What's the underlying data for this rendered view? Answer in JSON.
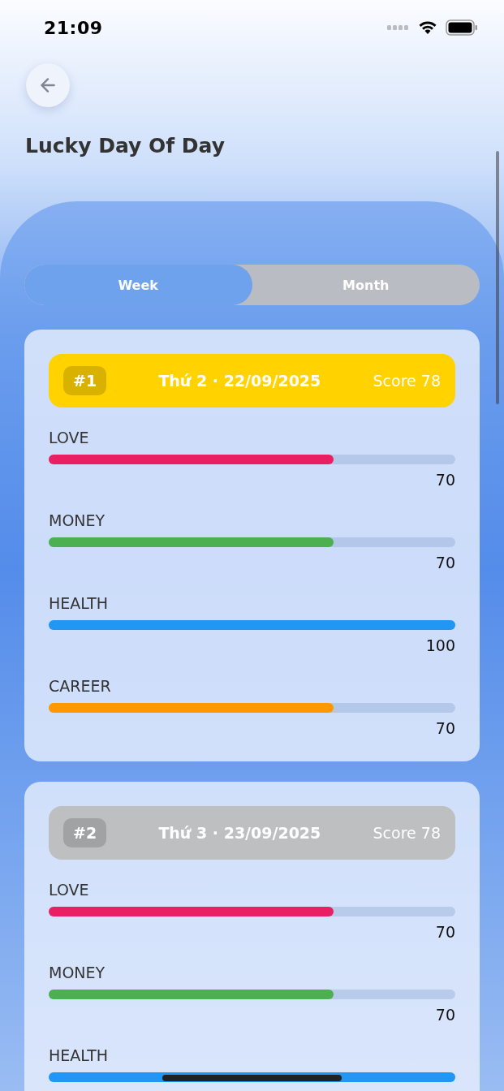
{
  "status_bar": {
    "time": "21:09"
  },
  "title": "Lucky Day Of Day",
  "tabs": [
    {
      "label": "Week",
      "selected": true
    },
    {
      "label": "Month",
      "selected": false
    }
  ],
  "days": [
    {
      "rank": "#1",
      "date": "Thứ 2 · 22/09/2025",
      "score": "Score 78",
      "color": "#ffd200",
      "metrics": [
        {
          "label": "LOVE",
          "level": 0.7,
          "value": "70",
          "color": "#e91e63"
        },
        {
          "label": "MONEY",
          "level": 0.7,
          "value": "70",
          "color": "#4caf50"
        },
        {
          "label": "HEALTH",
          "level": 1.0,
          "value": "100",
          "color": "#2196f3"
        },
        {
          "label": "CAREER",
          "level": 0.7,
          "value": "70",
          "color": "#ff9800"
        }
      ]
    },
    {
      "rank": "#2",
      "date": "Thứ 3 · 23/09/2025",
      "score": "Score 78",
      "color": "#bdbfc0",
      "metrics": [
        {
          "label": "LOVE",
          "level": 0.7,
          "value": "70",
          "color": "#e91e63"
        },
        {
          "label": "MONEY",
          "level": 0.7,
          "value": "70",
          "color": "#4caf50"
        },
        {
          "label": "HEALTH",
          "level": 1.0,
          "color": "#2196f3"
        }
      ]
    }
  ]
}
